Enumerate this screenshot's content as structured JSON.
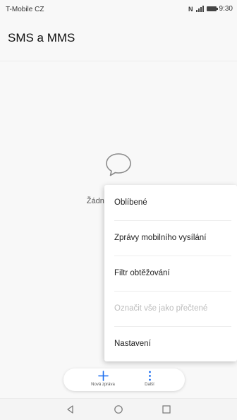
{
  "status_bar": {
    "carrier": "T-Mobile CZ",
    "nfc": "N",
    "time": "9:30"
  },
  "app": {
    "title": "SMS a MMS"
  },
  "empty_state": {
    "icon": "chat-bubble-icon",
    "text": "Žádné konverzace"
  },
  "menu": {
    "items": [
      {
        "label": "Oblíbené",
        "enabled": true
      },
      {
        "label": "Zprávy mobilního vysílání",
        "enabled": true
      },
      {
        "label": "Filtr obtěžování",
        "enabled": true
      },
      {
        "label": "Označit vše jako přečtené",
        "enabled": false
      },
      {
        "label": "Nastavení",
        "enabled": true
      }
    ]
  },
  "bottom_bar": {
    "new_message_label": "Nová zpráva",
    "more_label": "Další",
    "accent": "#1e6ff0"
  },
  "navbar": {
    "icons": [
      "back-icon",
      "home-icon",
      "recents-icon"
    ]
  }
}
